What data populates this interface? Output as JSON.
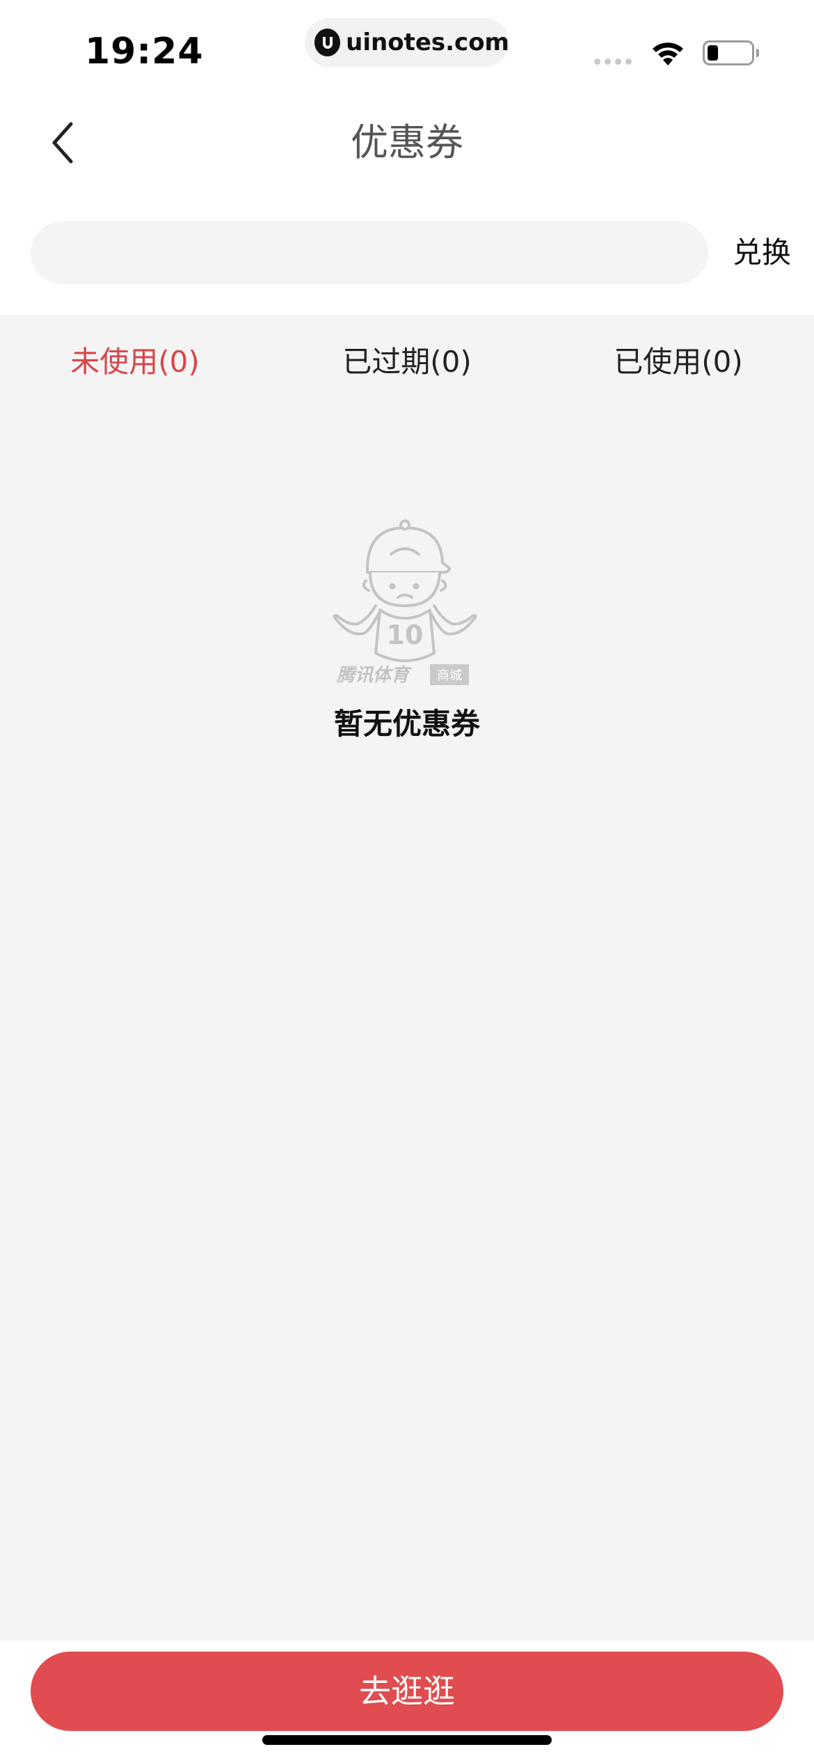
{
  "status_bar": {
    "time": "19:24",
    "url": "uinotes.com",
    "battery_level": 0.25
  },
  "nav": {
    "title": "优惠券",
    "back_icon": "chevron-left-icon"
  },
  "redeem": {
    "input_value": "",
    "input_placeholder": "",
    "button_label": "兑换"
  },
  "tabs": [
    {
      "label": "未使用(0)",
      "active": true
    },
    {
      "label": "已过期(0)",
      "active": false
    },
    {
      "label": "已使用(0)",
      "active": false
    }
  ],
  "empty_state": {
    "illustration": "mascot-shrug-icon",
    "jersey_number": "10",
    "brand": "腾讯体育",
    "brand_tag": "商城",
    "message": "暂无优惠券"
  },
  "bottom": {
    "cta_label": "去逛逛"
  },
  "colors": {
    "accent": "#e04c4f",
    "tab_active": "#d8454a",
    "background": "#f4f4f4"
  }
}
